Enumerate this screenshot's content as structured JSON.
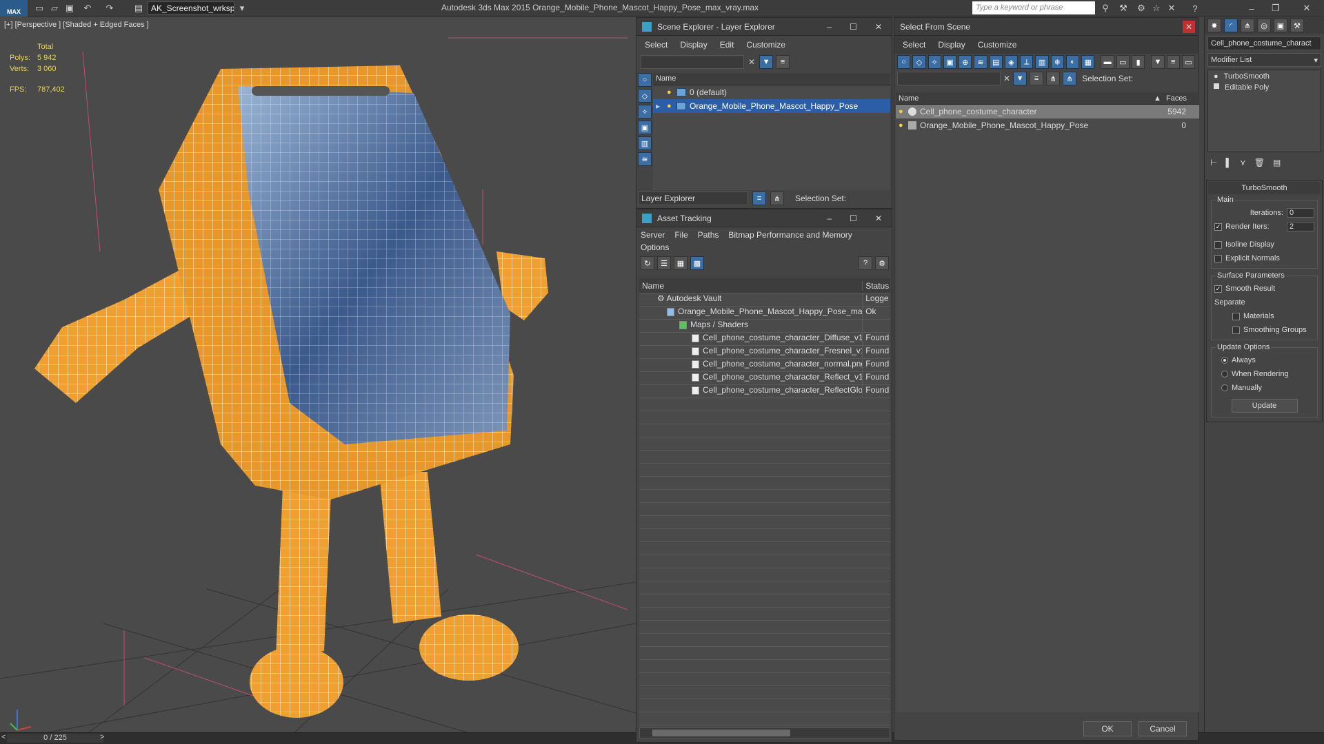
{
  "app": {
    "logo": "MAX",
    "workspace": "AK_Screenshot_wrksp",
    "title": "Autodesk 3ds Max  2015     Orange_Mobile_Phone_Mascot_Happy_Pose_max_vray.max",
    "search_placeholder": "Type a keyword or phrase"
  },
  "viewport": {
    "label": "[+] [Perspective ] [Shaded + Edged Faces ]",
    "stats": {
      "total_label": "Total",
      "polys_label": "Polys:",
      "polys_value": "5 942",
      "verts_label": "Verts:",
      "verts_value": "3 060",
      "fps_label": "FPS:",
      "fps_value": "787,402"
    },
    "frame_counter": "0 / 225"
  },
  "scene_explorer": {
    "title": "Scene Explorer - Layer Explorer",
    "menu": [
      "Select",
      "Display",
      "Edit",
      "Customize"
    ],
    "column_name": "Name",
    "rows": [
      {
        "label": "0 (default)"
      },
      {
        "label": "Orange_Mobile_Phone_Mascot_Happy_Pose"
      }
    ],
    "footer_dropdown": "Layer Explorer",
    "selection_set_label": "Selection Set:"
  },
  "asset_tracking": {
    "title": "Asset Tracking",
    "menu": [
      "Server",
      "File",
      "Paths",
      "Bitmap Performance and Memory",
      "Options"
    ],
    "col_name": "Name",
    "col_status": "Status",
    "rows": [
      {
        "name": "Autodesk Vault",
        "status": "Logge"
      },
      {
        "name": "Orange_Mobile_Phone_Mascot_Happy_Pose_ma...",
        "status": "Ok"
      },
      {
        "name": "Maps / Shaders",
        "status": ""
      },
      {
        "name": "Cell_phone_costume_character_Diffuse_v1...",
        "status": "Found"
      },
      {
        "name": "Cell_phone_costume_character_Fresnel_v1...",
        "status": "Found"
      },
      {
        "name": "Cell_phone_costume_character_normal.png",
        "status": "Found"
      },
      {
        "name": "Cell_phone_costume_character_Reflect_v1...",
        "status": "Found"
      },
      {
        "name": "Cell_phone_costume_character_ReflectGlo...",
        "status": "Found"
      }
    ]
  },
  "select_from_scene": {
    "title": "Select From Scene",
    "menu": [
      "Select",
      "Display",
      "Customize"
    ],
    "selection_set_label": "Selection Set:",
    "col_name": "Name",
    "col_faces": "Faces",
    "rows": [
      {
        "name": "Cell_phone_costume_character",
        "faces": "5942"
      },
      {
        "name": "Orange_Mobile_Phone_Mascot_Happy_Pose",
        "faces": "0"
      }
    ],
    "ok_label": "OK",
    "cancel_label": "Cancel"
  },
  "modify_panel": {
    "object_name": "Cell_phone_costume_charact",
    "modifier_list_label": "Modifier List",
    "stack": [
      "TurboSmooth",
      "Editable Poly"
    ],
    "rollout_title": "TurboSmooth",
    "main_label": "Main",
    "iterations_label": "Iterations:",
    "iterations_value": "0",
    "render_iters_label": "Render Iters:",
    "render_iters_value": "2",
    "isoline_label": "Isoline Display",
    "explicit_normals_label": "Explicit Normals",
    "surface_params_label": "Surface Parameters",
    "smooth_result_label": "Smooth Result",
    "separate_label": "Separate",
    "materials_label": "Materials",
    "smoothing_groups_label": "Smoothing Groups",
    "update_options_label": "Update Options",
    "always_label": "Always",
    "when_rendering_label": "When Rendering",
    "manually_label": "Manually",
    "update_button": "Update"
  },
  "colors": {
    "selection": "#2c5ea8",
    "mesh": "#f0a030",
    "wire": "#ffffff",
    "stats_text": "#e8d35a"
  }
}
